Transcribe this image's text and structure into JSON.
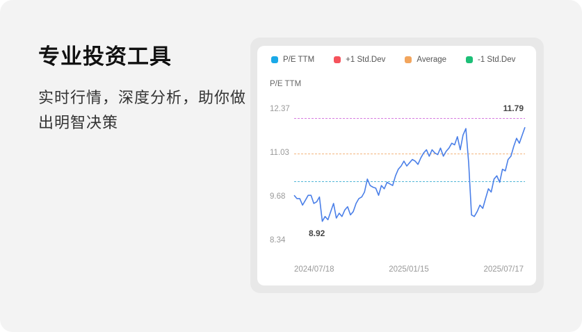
{
  "heading": "专业投资工具",
  "subheading": "实时行情，深度分析，助你做出明智决策",
  "chart_data": {
    "type": "line",
    "ylabel": "P/E TTM",
    "legend": [
      {
        "name": "P/E TTM",
        "color": "#1AA9E8"
      },
      {
        "name": "+1 Std.Dev",
        "color": "#F5535C"
      },
      {
        "name": "Average",
        "color": "#F2A55D"
      },
      {
        "name": "-1 Std.Dev",
        "color": "#1DBF77"
      }
    ],
    "y_ticks": [
      "12.37",
      "11.03",
      "9.68",
      "8.34"
    ],
    "y_tick_values": [
      12.37,
      11.03,
      9.68,
      8.34
    ],
    "x_ticks": [
      "2024/07/18",
      "2025/01/15",
      "2025/07/17"
    ],
    "ylim": [
      8.34,
      12.37
    ],
    "std_lines": {
      "plus1": 12.06,
      "average": 10.97,
      "minus1": 10.12
    },
    "annotations": {
      "max_label": "11.79",
      "min_label": "8.92"
    },
    "series": [
      {
        "name": "P/E TTM",
        "color": "#4A7FE8",
        "values": [
          9.7,
          9.6,
          9.6,
          9.4,
          9.55,
          9.7,
          9.7,
          9.45,
          9.5,
          9.65,
          8.9,
          9.05,
          8.95,
          9.2,
          9.45,
          9.0,
          9.15,
          9.05,
          9.25,
          9.35,
          9.1,
          9.2,
          9.45,
          9.6,
          9.65,
          9.8,
          10.2,
          10.0,
          9.95,
          9.92,
          9.7,
          10.0,
          9.9,
          10.1,
          10.05,
          10.0,
          10.3,
          10.5,
          10.6,
          10.75,
          10.6,
          10.7,
          10.8,
          10.75,
          10.65,
          10.85,
          11.0,
          11.1,
          10.9,
          11.1,
          11.0,
          10.95,
          11.15,
          10.9,
          11.05,
          11.15,
          11.3,
          11.25,
          11.5,
          11.1,
          11.55,
          11.75,
          10.7,
          9.1,
          9.05,
          9.2,
          9.4,
          9.3,
          9.6,
          9.9,
          9.8,
          10.2,
          10.3,
          10.1,
          10.5,
          10.45,
          10.8,
          10.9,
          11.2,
          11.45,
          11.3,
          11.55,
          11.79
        ]
      }
    ]
  }
}
